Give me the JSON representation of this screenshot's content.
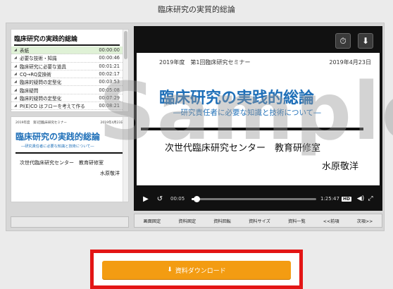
{
  "page": {
    "title": "臨床研究の実質的総論"
  },
  "chapters": {
    "title": "臨床研究の実践的総論",
    "items": [
      {
        "label": "表紙",
        "time": "00:00:00",
        "active": true
      },
      {
        "label": "必要な技術・知識",
        "time": "00:00:46"
      },
      {
        "label": "臨床研究に必要な道具",
        "time": "00:01:21"
      },
      {
        "label": "CQ→RQ変換術",
        "time": "00:02:17"
      },
      {
        "label": "臨床的疑問の定型化",
        "time": "00:03:53"
      },
      {
        "label": "臨床疑問",
        "time": "00:05:08"
      },
      {
        "label": "臨床的疑問の定型化",
        "time": "00:07:29"
      },
      {
        "label": "PI(E)CO はフローを考えて作る",
        "time": "00:08:21"
      }
    ]
  },
  "slide": {
    "seminar": "2019年度　第1回臨床研究セミナー",
    "date": "2019年4月23日",
    "title": "臨床研究の実践的総論",
    "subtitle": "―研究責任者に必要な知識と技術について―",
    "organization": "次世代臨床研究センター　教育研修室",
    "presenter": "水原敬洋"
  },
  "mini_slide": {
    "seminar": "2019年度　第1回臨床研究セミナー",
    "date": "2019年4月23日"
  },
  "player": {
    "current_time": "00:05",
    "duration": "1:25:47",
    "progress": 0.04,
    "hd_label": "HD",
    "icons": {
      "clock": "clock-icon",
      "download": "download-icon",
      "play": "play-icon",
      "rewind": "rewind-10-icon",
      "volume": "volume-icon",
      "fullscreen": "fullscreen-icon"
    }
  },
  "toolbar": {
    "items": [
      "画面固定",
      "資料固定",
      "資料回転",
      "資料サイズ",
      "資料一覧",
      "<<前項",
      "次項>>"
    ]
  },
  "watermark": "Sample",
  "download": {
    "label": "資料ダウンロード",
    "icon": "download-icon"
  },
  "colors": {
    "accent_orange": "#f39c12",
    "highlight_red": "#e31515",
    "slide_blue": "#1e6fb8",
    "active_row": "#dff1d6"
  }
}
